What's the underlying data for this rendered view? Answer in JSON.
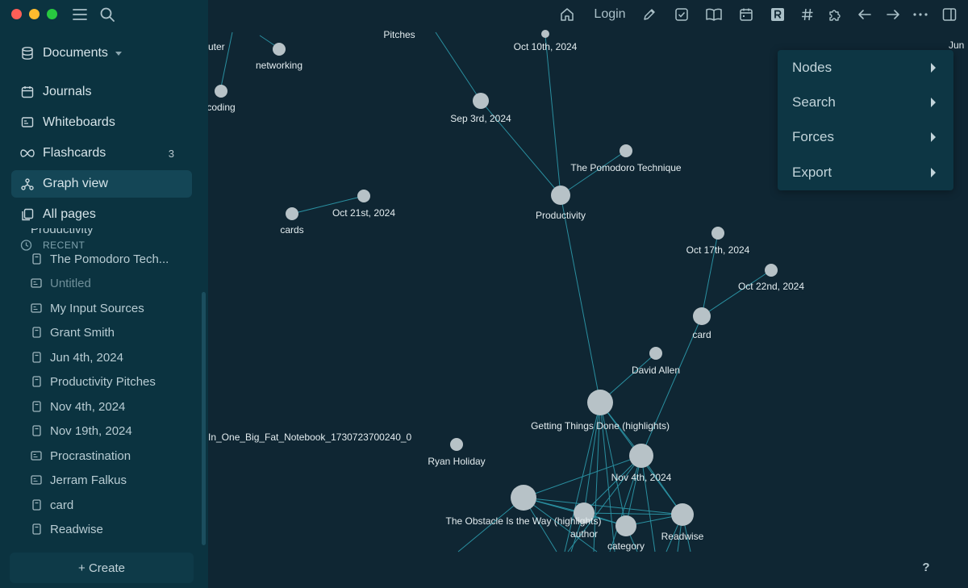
{
  "sidebar": {
    "workspace": "Documents",
    "nav": [
      {
        "label": "Journals",
        "icon": "calendar-icon"
      },
      {
        "label": "Whiteboards",
        "icon": "whiteboard-icon"
      },
      {
        "label": "Flashcards",
        "icon": "infinity-icon",
        "badge": "3"
      },
      {
        "label": "Graph view",
        "icon": "graph-icon",
        "active": true
      },
      {
        "label": "All pages",
        "icon": "pages-icon"
      }
    ],
    "recent_header": "RECENT",
    "recent_clipped": "Productivity",
    "recent": [
      {
        "label": "The Pomodoro Tech...",
        "icon": "page-icon"
      },
      {
        "label": "Untitled",
        "icon": "whiteboard-icon",
        "dim": true
      },
      {
        "label": "My Input Sources",
        "icon": "whiteboard-icon"
      },
      {
        "label": "Grant Smith",
        "icon": "page-icon"
      },
      {
        "label": "Jun 4th, 2024",
        "icon": "page-icon"
      },
      {
        "label": "Productivity Pitches",
        "icon": "page-icon"
      },
      {
        "label": "Nov 4th, 2024",
        "icon": "page-icon"
      },
      {
        "label": "Nov 19th, 2024",
        "icon": "page-icon"
      },
      {
        "label": "Procrastination",
        "icon": "whiteboard-icon"
      },
      {
        "label": "Jerram Falkus",
        "icon": "whiteboard-icon"
      },
      {
        "label": "card",
        "icon": "page-icon"
      },
      {
        "label": "Readwise",
        "icon": "page-icon"
      }
    ],
    "create_label": "+ Create"
  },
  "toolbar": {
    "login_label": "Login",
    "icons": [
      "home-icon",
      "pencil-icon",
      "checkbox-icon",
      "book-icon",
      "calendar-icon",
      "readwise-icon",
      "hashtag-icon",
      "puzzle-icon",
      "back-arrow-icon",
      "forward-arrow-icon",
      "more-icon",
      "sidebar-toggle-icon"
    ]
  },
  "graph_menu": {
    "items": [
      "Nodes",
      "Search",
      "Forces",
      "Export"
    ]
  },
  "help_label": "?",
  "graph": {
    "nodes": [
      {
        "id": "n_uter",
        "label": "uter"
      },
      {
        "id": "n_networking",
        "label": "networking"
      },
      {
        "id": "n_coding",
        "label": "coding"
      },
      {
        "id": "n_pitches",
        "label": "Pitches"
      },
      {
        "id": "n_oct10",
        "label": "Oct 10th, 2024"
      },
      {
        "id": "n_jun",
        "label": "Jun"
      },
      {
        "id": "n_sep3",
        "label": "Sep 3rd, 2024"
      },
      {
        "id": "n_pomodoro",
        "label": "The Pomodoro Technique"
      },
      {
        "id": "n_productivity",
        "label": "Productivity"
      },
      {
        "id": "n_oct21",
        "label": "Oct 21st, 2024"
      },
      {
        "id": "n_cards",
        "label": "cards"
      },
      {
        "id": "n_oct17",
        "label": "Oct 17th, 2024"
      },
      {
        "id": "n_oct22",
        "label": "Oct 22nd, 2024"
      },
      {
        "id": "n_card",
        "label": "card"
      },
      {
        "id": "n_davidallen",
        "label": "David Allen"
      },
      {
        "id": "n_gtd",
        "label": "Getting Things Done (highlights)"
      },
      {
        "id": "n_notebook",
        "label": "In_One_Big_Fat_Notebook_1730723700240_0"
      },
      {
        "id": "n_ryan",
        "label": "Ryan Holiday"
      },
      {
        "id": "n_nov4",
        "label": "Nov 4th, 2024"
      },
      {
        "id": "n_obstacle",
        "label": "The Obstacle Is the Way (highlights)"
      },
      {
        "id": "n_author",
        "label": "author"
      },
      {
        "id": "n_category",
        "label": "category"
      },
      {
        "id": "n_readwise",
        "label": "Readwise"
      }
    ]
  }
}
